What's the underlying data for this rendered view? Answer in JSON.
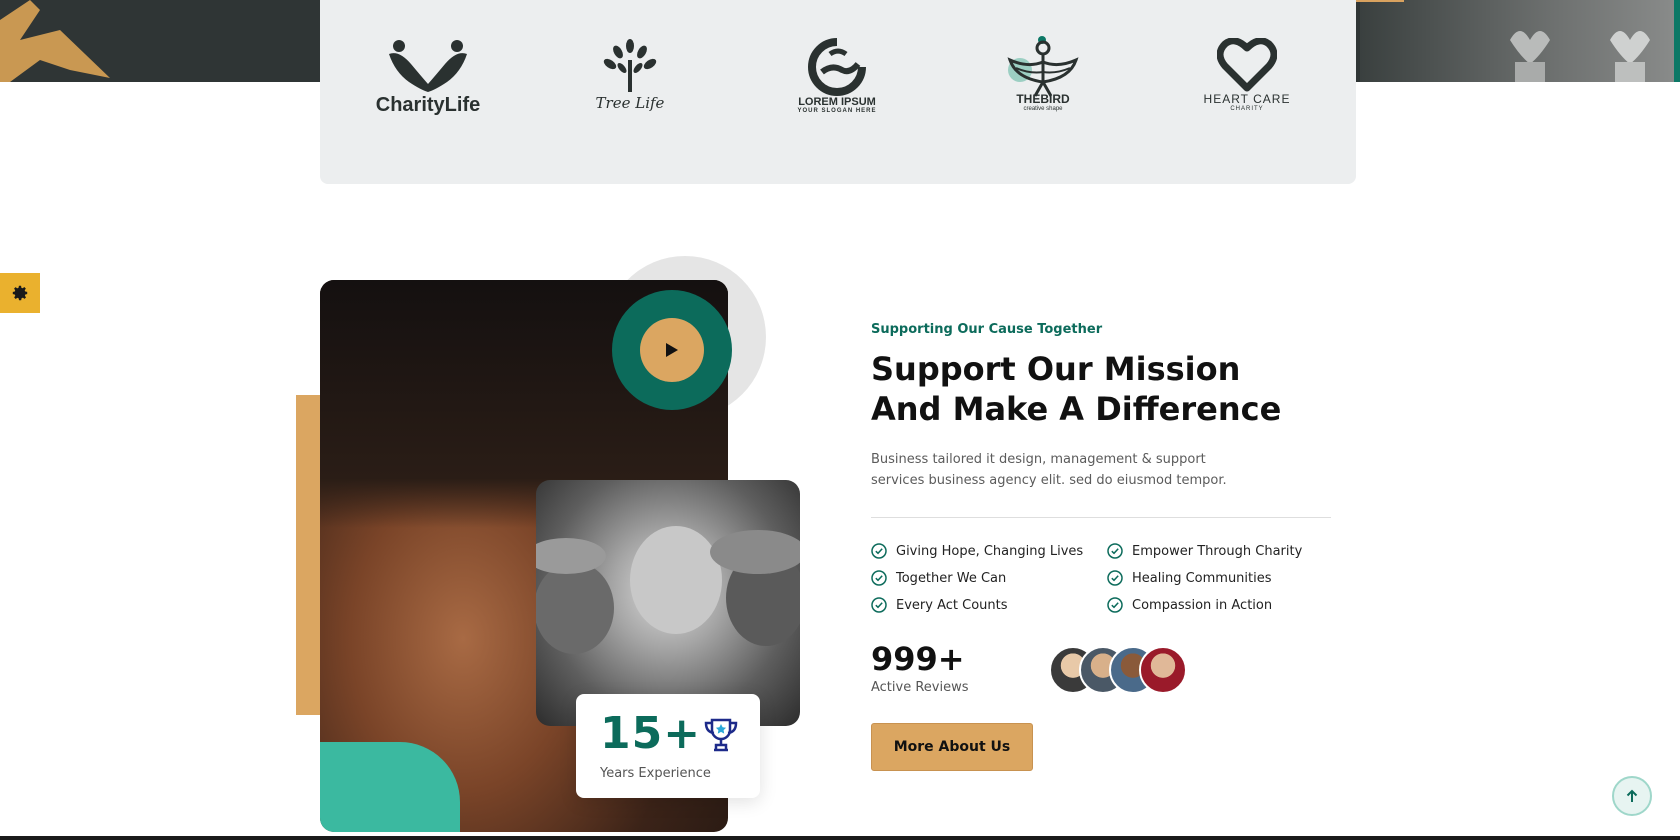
{
  "brands": [
    {
      "name": "CharityLife",
      "sub": ""
    },
    {
      "name": "Tree Life",
      "sub": ""
    },
    {
      "name": "LOREM IPSUM",
      "sub": "YOUR SLOGAN HERE"
    },
    {
      "name": "THEBIRD",
      "sub": "creative shape"
    },
    {
      "name": "HEART CARE",
      "sub": "CHARITY"
    }
  ],
  "experience": {
    "number": "15+",
    "label": "Years Experience"
  },
  "about": {
    "eyebrow": "Supporting Our Cause Together",
    "headline_line1": "Support Our Mission",
    "headline_line2": "And Make A Difference",
    "description": "Business tailored it design, management & support services business agency elit. sed do eiusmod tempor.",
    "features": [
      "Giving Hope, Changing Lives",
      "Empower Through Charity",
      "Together We Can",
      "Healing Communities",
      "Every Act Counts",
      "Compassion in Action"
    ],
    "reviews_count": "999+",
    "reviews_label": "Active Reviews",
    "button_label": "More About Us"
  },
  "colors": {
    "primary": "#0c6b5b",
    "accent": "#dba661",
    "settings": "#eab12e",
    "brand_bar": "#eceeef"
  },
  "icons": {
    "settings": "gear-icon",
    "play": "play-icon",
    "trophy": "trophy-icon",
    "check": "check-circle-icon",
    "scroll_top": "arrow-up-icon"
  }
}
